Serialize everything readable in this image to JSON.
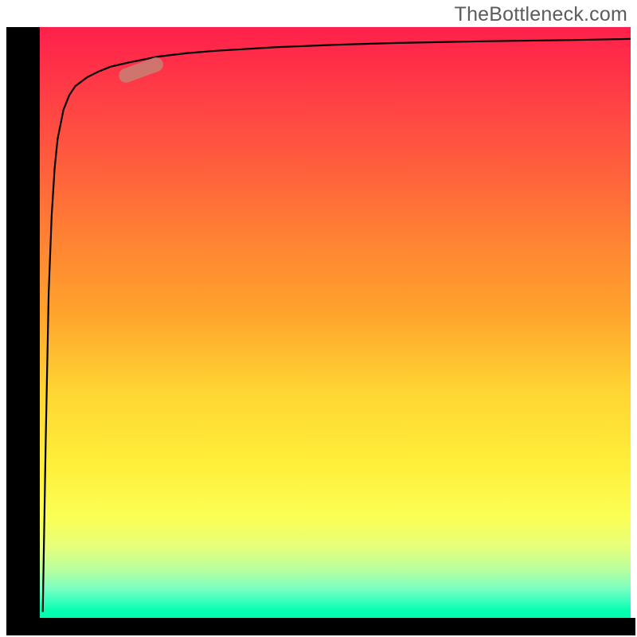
{
  "watermark": "TheBottleneck.com",
  "colors": {
    "axis": "#000000",
    "curve": "#000000",
    "marker": "#cc7a72",
    "text": "#5c5c5c",
    "gradient_top": "#ff1f4b",
    "gradient_bottom": "#00ffad"
  },
  "chart_data": {
    "type": "line",
    "title": "",
    "xlabel": "",
    "ylabel": "",
    "xlim": [
      0,
      100
    ],
    "ylim": [
      0,
      100
    ],
    "grid": false,
    "legend": false,
    "series": [
      {
        "name": "bottleneck-curve",
        "x": [
          0.5,
          1,
          1.5,
          2,
          2.5,
          3,
          4,
          5,
          6,
          8,
          10,
          12,
          15,
          20,
          25,
          30,
          40,
          50,
          60,
          75,
          90,
          100
        ],
        "y": [
          1,
          30,
          55,
          68,
          76,
          81,
          86,
          88.5,
          90,
          91.5,
          92.5,
          93.3,
          94,
          95,
          95.6,
          96,
          96.6,
          97,
          97.3,
          97.6,
          97.8,
          98
        ]
      }
    ],
    "marker": {
      "series": "bottleneck-curve",
      "x": 16.5,
      "y": 92.5,
      "angle_deg": 20
    },
    "annotations": []
  }
}
